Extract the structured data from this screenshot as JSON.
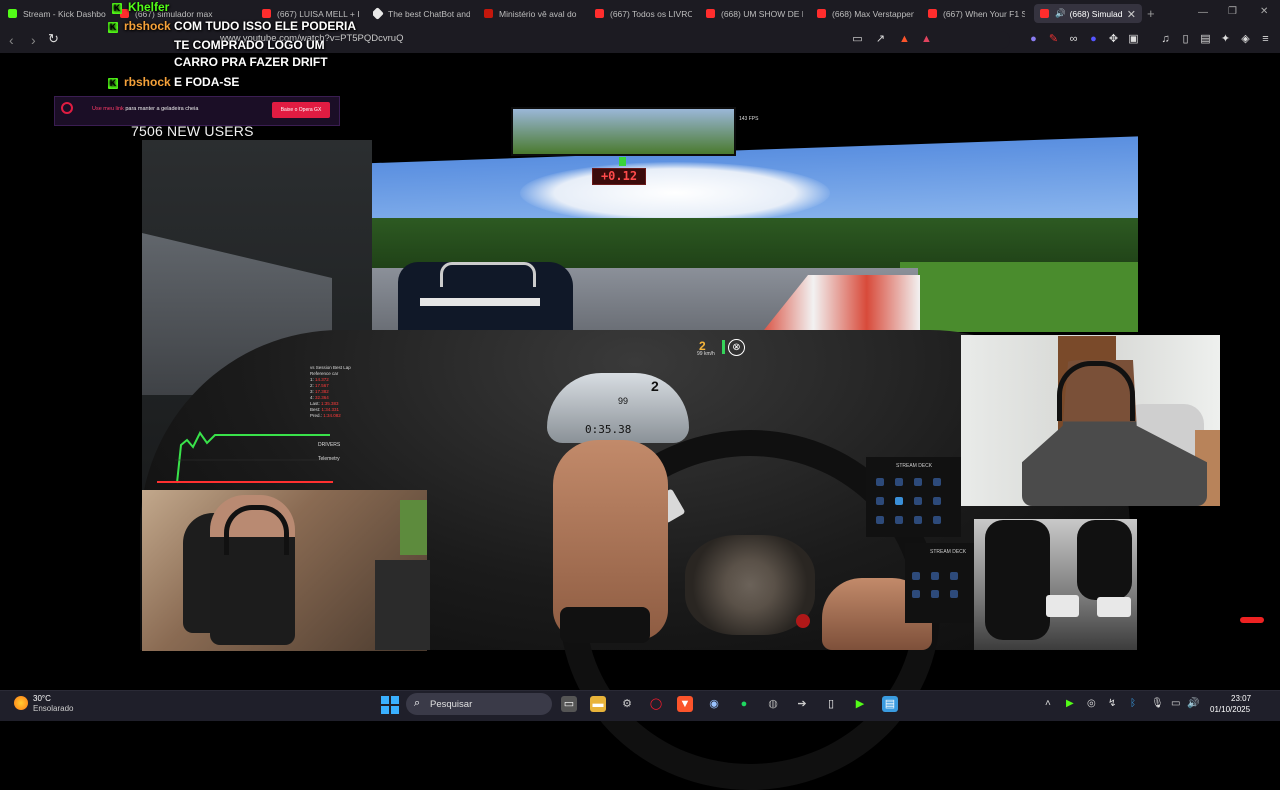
{
  "browser": {
    "tabs": [
      {
        "label": "Stream - Kick Dashbo",
        "color": "#53fc18"
      },
      {
        "label": "(667) simulador max",
        "color": "#ff2d2d"
      },
      {
        "label": "(667) LUISA MELL + IO",
        "color": "#ff2d2d"
      },
      {
        "label": "The best ChatBot and",
        "color": "#e8e8e8"
      },
      {
        "label": "Ministério vê aval do",
        "color": "#c4170c"
      },
      {
        "label": "(667) Todos os LIVRO",
        "color": "#ff2d2d"
      },
      {
        "label": "(668) UM SHOW DE R",
        "color": "#ff2d2d"
      },
      {
        "label": "(668) Max Verstappen",
        "color": "#ff2d2d"
      },
      {
        "label": "(667) When Your F1 S",
        "color": "#ff2d2d"
      },
      {
        "label": "(668) Simulad",
        "color": "#ff2d2d"
      }
    ],
    "new_tab_symbol": "+",
    "url": "www.youtube.com/watch?v=PT5PQDcvruQ"
  },
  "chat": [
    {
      "user": "Khelfer",
      "message": ""
    },
    {
      "user": "rbshock",
      "message": "COM TUDO ISSO ELE PODERIA"
    },
    {
      "user": "",
      "message": "TE COMPRADO LOGO UM"
    },
    {
      "user": "",
      "message": "CARRO PRA FAZER DRIFT"
    },
    {
      "user": "rbshock",
      "message": "E FODA-SE"
    }
  ],
  "overlay": {
    "banner_link": "Use meu link",
    "banner_text": "para manter a geladeira cheia",
    "banner_button": "Baixe o Opera GX",
    "new_users": "7506 NEW USERS"
  },
  "game_hud": {
    "delta": "+0.12",
    "mirror_fps": "143 FPS",
    "gear": "2",
    "speed_unit": "99 km/h",
    "gauge_gear": "2",
    "gauge_speed": "99",
    "gauge_laptime": "0:35.38",
    "telemetry_title": "vs Session Best Lap",
    "telemetry_rows": [
      {
        "label": "Reference car",
        "value": ""
      },
      {
        "label": "1:",
        "value": "14.372"
      },
      {
        "label": "2:",
        "value": "17.567"
      },
      {
        "label": "3:",
        "value": "17.382"
      },
      {
        "label": "4:",
        "value": "32.364"
      },
      {
        "label": "Last:",
        "value": "1:35.383"
      },
      {
        "label": "Best:",
        "value": "1:34.331"
      },
      {
        "label": "Pred.:",
        "value": "1:34.082"
      }
    ],
    "graph_labels": [
      "DRIVERS",
      "Telemetry"
    ],
    "stream_deck_label": "STREAM DECK"
  },
  "taskbar": {
    "weather_temp": "30°C",
    "weather_desc": "Ensolarado",
    "search_placeholder": "Pesquisar",
    "time": "23:07",
    "date": "01/10/2025"
  }
}
